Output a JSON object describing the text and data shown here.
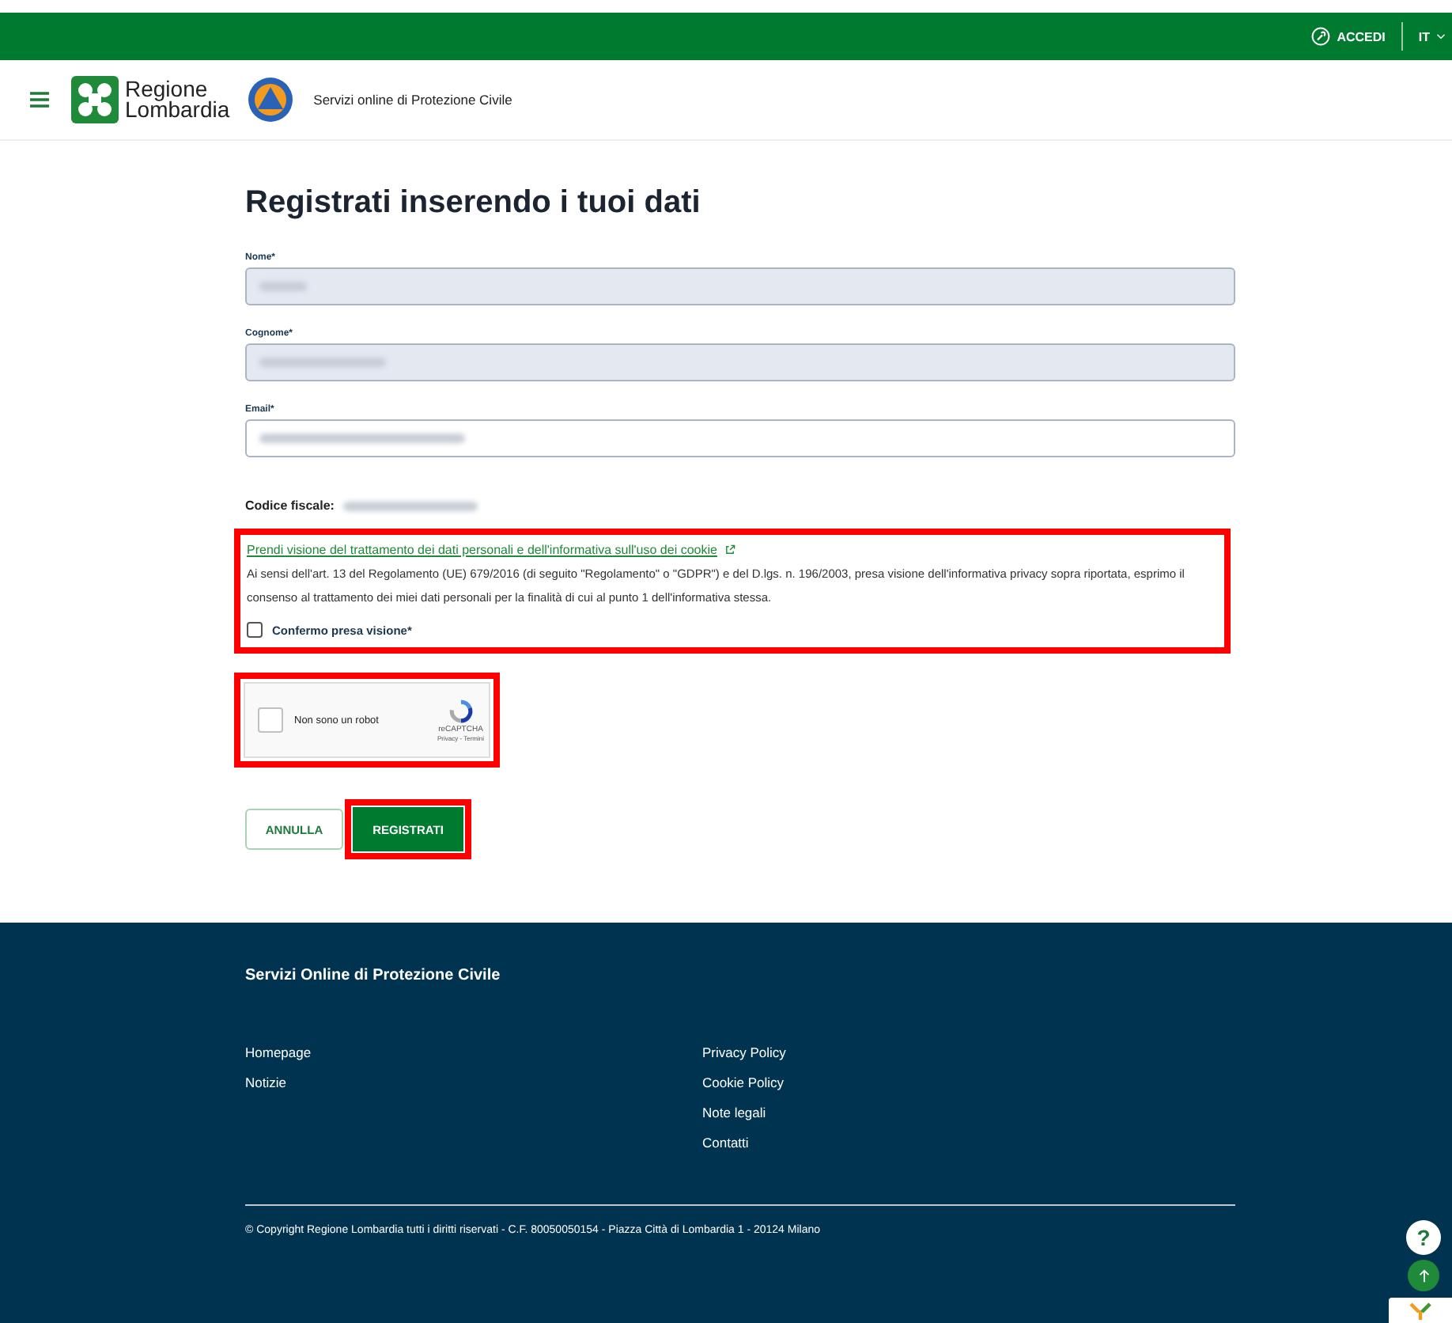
{
  "top_bar": {
    "login": "ACCEDI",
    "language": "IT"
  },
  "header": {
    "logo_text": [
      "Regione",
      "Lombardia"
    ],
    "service_title": "Servizi online di Protezione Civile"
  },
  "form": {
    "title": "Registrati inserendo i tuoi dati",
    "fields": [
      {
        "label": "Nome*",
        "disabled": true
      },
      {
        "label": "Cognome*",
        "disabled": true
      },
      {
        "label": "Email*",
        "disabled": false
      }
    ],
    "fiscal_code_label": "Codice fiscale:",
    "privacy": {
      "link": "Prendi visione del trattamento dei dati personali e dell'informativa sull'uso dei cookie",
      "text": "Ai sensi dell'art. 13 del Regolamento (UE) 679/2016 (di seguito \"Regolamento\" o \"GDPR\") e del D.lgs. n. 196/2003, presa visione dell'informativa privacy sopra riportata, esprimo il consenso al trattamento dei miei dati personali per la finalità di cui al punto 1 dell'informativa stessa.",
      "checkbox_label": "Confermo presa visione*",
      "checked": false
    },
    "captcha": {
      "label": "Non sono un robot",
      "brand": "reCAPTCHA",
      "links": "Privacy - Termini",
      "checked": false
    },
    "buttons": [
      "ANNULLA",
      "REGISTRATI"
    ]
  },
  "footer": {
    "title": "Servizi Online di Protezione Civile",
    "links_left": [
      "Homepage",
      "Notizie"
    ],
    "links_right": [
      "Privacy Policy",
      "Cookie Policy",
      "Note legali",
      "Contatti"
    ],
    "copyright": "© Copyright Regione Lombardia tutti i diritti riservati - C.F. 80050050154 - Piazza Città di Lombardia 1 - 20124 Milano"
  },
  "help_button": "?"
}
